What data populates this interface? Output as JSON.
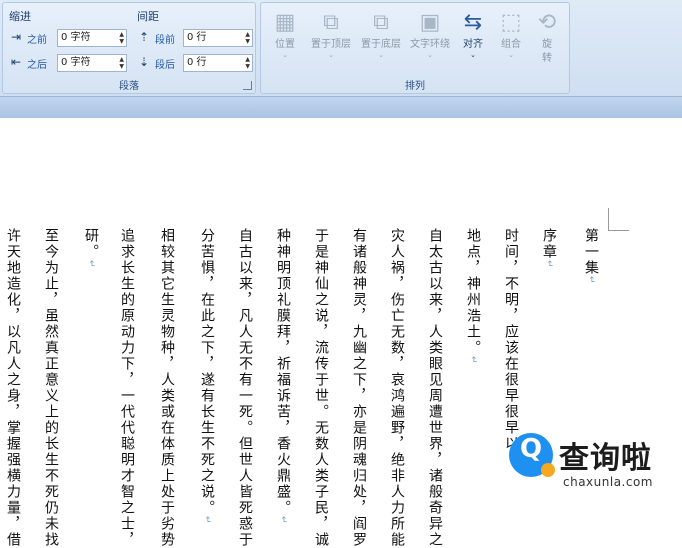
{
  "ribbon": {
    "paragraph_group": {
      "title": "段落",
      "indent_label": "缩进",
      "spacing_label": "间距",
      "indent_before_label": "之前",
      "indent_before_value": "0 字符",
      "indent_after_label": "之后",
      "indent_after_value": "0 字符",
      "spacing_before_label": "段前",
      "spacing_before_value": "0 行",
      "spacing_after_label": "段后",
      "spacing_after_value": "0 行"
    },
    "arrange_group": {
      "title": "排列",
      "buttons": [
        {
          "label": "位置",
          "icon": "position-icon",
          "dropdown": "⌄"
        },
        {
          "label": "置于顶层",
          "icon": "bring-to-front-icon",
          "dropdown": "⌄"
        },
        {
          "label": "置于底层",
          "icon": "send-to-back-icon",
          "dropdown": "⌄"
        },
        {
          "label": "文字环绕",
          "icon": "text-wrap-icon",
          "dropdown": "⌄"
        },
        {
          "label": "对齐",
          "icon": "align-icon",
          "dropdown": "⌄"
        },
        {
          "label": "组合",
          "icon": "group-icon",
          "dropdown": "⌄"
        },
        {
          "label": "旋",
          "label2": "转",
          "icon": "rotate-icon",
          "dropdown": "⌄"
        }
      ]
    }
  },
  "document": {
    "columns": [
      {
        "text": "第一集",
        "mark": "↵"
      },
      {
        "text": "时间，不明，应该在很早很早以"
      },
      {
        "text": "序章",
        "mark": "↵"
      },
      {
        "text": "地点，神州浩土。",
        "mark": "↵"
      },
      {
        "text": "自太古以来，人类眼见周遭世界，诸般奇异之"
      },
      {
        "text": "灾人祸，伤亡无数，哀鸿遍野，绝非人力所能"
      },
      {
        "text": "有诸般神灵，九幽之下，亦是阴魂归处，阎罗"
      },
      {
        "text": "于是神仙之说，流传于世。无数人类子民，诚"
      },
      {
        "text": "种神明顶礼膜拜，祈福诉苦，香火鼎盛。",
        "mark": "↵"
      },
      {
        "text": "自古以来，凡人无不有一死。但世人皆死惑于"
      },
      {
        "text": "分苦惧，在此之下，遂有长生不死之说。",
        "mark": "↵"
      },
      {
        "text": "相较其它生灵物种，人类或在体质上处于劣势"
      },
      {
        "text": "追求长生的原动力下，一代代聪明才智之士，"
      },
      {
        "text": "研。",
        "mark": "↵"
      },
      {
        "text": "至今为止，虽然真正意义上的长生不死仍未找"
      },
      {
        "text": "许天地造化，以凡人之身，掌握强横力量，借"
      }
    ]
  },
  "watermark": {
    "icon_glyph": "Q",
    "title": "查询啦",
    "url": "chaxunla.com"
  },
  "colors": {
    "ribbon_bg": "#dfeaf7",
    "ribbon_band": "#b6cce8",
    "label_blue": "#2557a7",
    "watermark_blue": "#1e90f0",
    "watermark_orange": "#f6a91e"
  }
}
